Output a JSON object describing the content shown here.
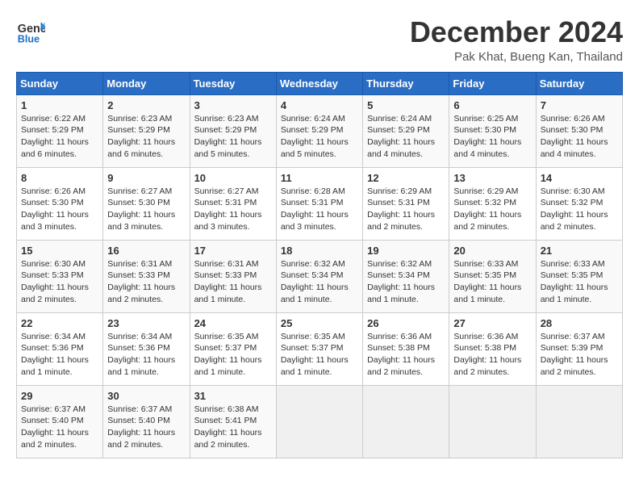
{
  "logo": {
    "line1": "General",
    "line2": "Blue"
  },
  "title": "December 2024",
  "location": "Pak Khat, Bueng Kan, Thailand",
  "days_of_week": [
    "Sunday",
    "Monday",
    "Tuesday",
    "Wednesday",
    "Thursday",
    "Friday",
    "Saturday"
  ],
  "weeks": [
    [
      {
        "day": 1,
        "sunrise": "6:22 AM",
        "sunset": "5:29 PM",
        "daylight": "11 hours and 6 minutes."
      },
      {
        "day": 2,
        "sunrise": "6:23 AM",
        "sunset": "5:29 PM",
        "daylight": "11 hours and 6 minutes."
      },
      {
        "day": 3,
        "sunrise": "6:23 AM",
        "sunset": "5:29 PM",
        "daylight": "11 hours and 5 minutes."
      },
      {
        "day": 4,
        "sunrise": "6:24 AM",
        "sunset": "5:29 PM",
        "daylight": "11 hours and 5 minutes."
      },
      {
        "day": 5,
        "sunrise": "6:24 AM",
        "sunset": "5:29 PM",
        "daylight": "11 hours and 4 minutes."
      },
      {
        "day": 6,
        "sunrise": "6:25 AM",
        "sunset": "5:30 PM",
        "daylight": "11 hours and 4 minutes."
      },
      {
        "day": 7,
        "sunrise": "6:26 AM",
        "sunset": "5:30 PM",
        "daylight": "11 hours and 4 minutes."
      }
    ],
    [
      {
        "day": 8,
        "sunrise": "6:26 AM",
        "sunset": "5:30 PM",
        "daylight": "11 hours and 3 minutes."
      },
      {
        "day": 9,
        "sunrise": "6:27 AM",
        "sunset": "5:30 PM",
        "daylight": "11 hours and 3 minutes."
      },
      {
        "day": 10,
        "sunrise": "6:27 AM",
        "sunset": "5:31 PM",
        "daylight": "11 hours and 3 minutes."
      },
      {
        "day": 11,
        "sunrise": "6:28 AM",
        "sunset": "5:31 PM",
        "daylight": "11 hours and 3 minutes."
      },
      {
        "day": 12,
        "sunrise": "6:29 AM",
        "sunset": "5:31 PM",
        "daylight": "11 hours and 2 minutes."
      },
      {
        "day": 13,
        "sunrise": "6:29 AM",
        "sunset": "5:32 PM",
        "daylight": "11 hours and 2 minutes."
      },
      {
        "day": 14,
        "sunrise": "6:30 AM",
        "sunset": "5:32 PM",
        "daylight": "11 hours and 2 minutes."
      }
    ],
    [
      {
        "day": 15,
        "sunrise": "6:30 AM",
        "sunset": "5:33 PM",
        "daylight": "11 hours and 2 minutes."
      },
      {
        "day": 16,
        "sunrise": "6:31 AM",
        "sunset": "5:33 PM",
        "daylight": "11 hours and 2 minutes."
      },
      {
        "day": 17,
        "sunrise": "6:31 AM",
        "sunset": "5:33 PM",
        "daylight": "11 hours and 1 minute."
      },
      {
        "day": 18,
        "sunrise": "6:32 AM",
        "sunset": "5:34 PM",
        "daylight": "11 hours and 1 minute."
      },
      {
        "day": 19,
        "sunrise": "6:32 AM",
        "sunset": "5:34 PM",
        "daylight": "11 hours and 1 minute."
      },
      {
        "day": 20,
        "sunrise": "6:33 AM",
        "sunset": "5:35 PM",
        "daylight": "11 hours and 1 minute."
      },
      {
        "day": 21,
        "sunrise": "6:33 AM",
        "sunset": "5:35 PM",
        "daylight": "11 hours and 1 minute."
      }
    ],
    [
      {
        "day": 22,
        "sunrise": "6:34 AM",
        "sunset": "5:36 PM",
        "daylight": "11 hours and 1 minute."
      },
      {
        "day": 23,
        "sunrise": "6:34 AM",
        "sunset": "5:36 PM",
        "daylight": "11 hours and 1 minute."
      },
      {
        "day": 24,
        "sunrise": "6:35 AM",
        "sunset": "5:37 PM",
        "daylight": "11 hours and 1 minute."
      },
      {
        "day": 25,
        "sunrise": "6:35 AM",
        "sunset": "5:37 PM",
        "daylight": "11 hours and 1 minute."
      },
      {
        "day": 26,
        "sunrise": "6:36 AM",
        "sunset": "5:38 PM",
        "daylight": "11 hours and 2 minutes."
      },
      {
        "day": 27,
        "sunrise": "6:36 AM",
        "sunset": "5:38 PM",
        "daylight": "11 hours and 2 minutes."
      },
      {
        "day": 28,
        "sunrise": "6:37 AM",
        "sunset": "5:39 PM",
        "daylight": "11 hours and 2 minutes."
      }
    ],
    [
      {
        "day": 29,
        "sunrise": "6:37 AM",
        "sunset": "5:40 PM",
        "daylight": "11 hours and 2 minutes."
      },
      {
        "day": 30,
        "sunrise": "6:37 AM",
        "sunset": "5:40 PM",
        "daylight": "11 hours and 2 minutes."
      },
      {
        "day": 31,
        "sunrise": "6:38 AM",
        "sunset": "5:41 PM",
        "daylight": "11 hours and 2 minutes."
      },
      null,
      null,
      null,
      null
    ]
  ]
}
